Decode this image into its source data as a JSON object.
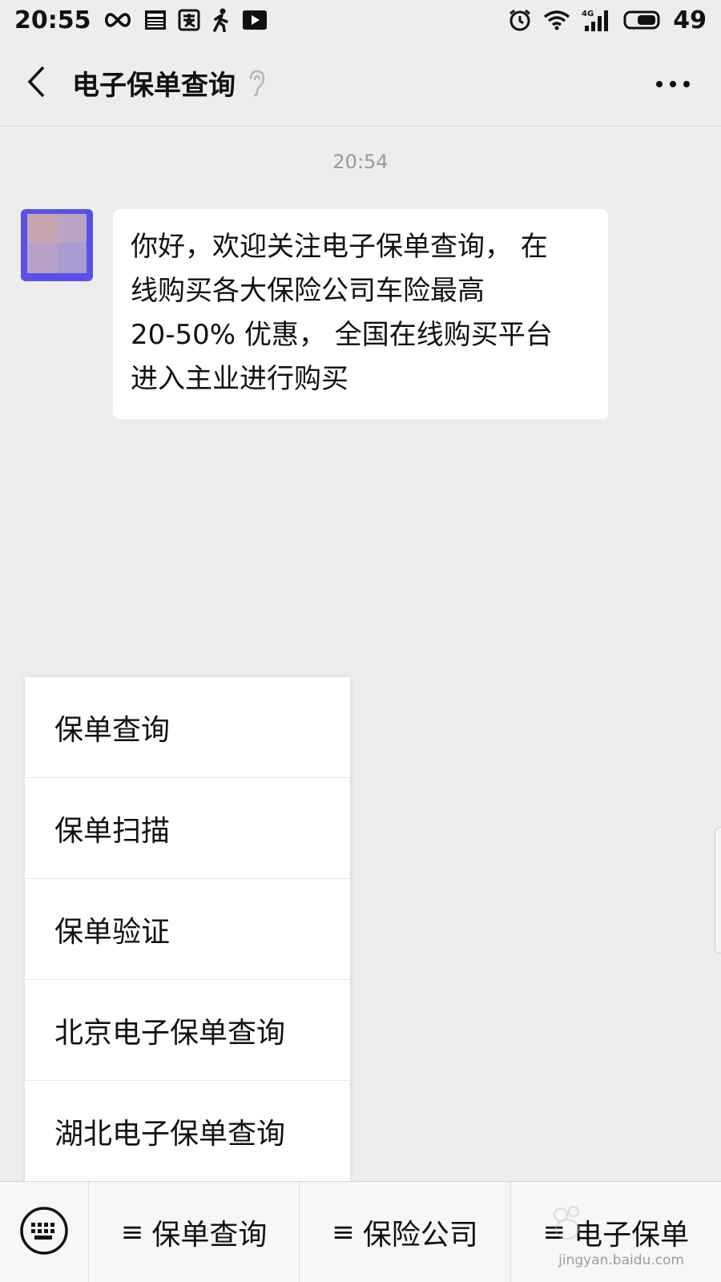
{
  "status_bar": {
    "time": "20:55",
    "battery_level": "49",
    "left_icons": [
      "infinity-icon",
      "news-icon",
      "pay-icon",
      "walk-icon",
      "video-icon"
    ],
    "right_icons": [
      "alarm-icon",
      "wifi-icon",
      "signal-4g-icon",
      "battery-icon"
    ],
    "network_label": "4G"
  },
  "nav": {
    "title": "电子保单查询",
    "back_icon": "chevron-left-icon",
    "ear_icon": "ear-icon",
    "more_icon": "more-icon"
  },
  "chat": {
    "timestamp": "20:54",
    "message_lines": [
      "你好，欢迎关注电子保单查询， 在",
      "线购买各大保险公司车险最高",
      "20-50% 优惠， 全国在线购买平台",
      "进入主业进行购买"
    ]
  },
  "popup_menu": {
    "items": [
      "保单查询",
      "保单扫描",
      "保单验证",
      "北京电子保单查询",
      "湖北电子保单查询"
    ]
  },
  "bottom_menu": {
    "keyboard_icon": "keyboard-icon",
    "tab_icon": "≡",
    "tabs": [
      "保单查询",
      "保险公司",
      "电子保单"
    ]
  },
  "watermark": {
    "text": "jingyan.baidu.com"
  },
  "colors": {
    "background": "#ededed",
    "bubble": "#ffffff",
    "avatar": "#5a52e6",
    "timestamp": "#9a9a9a"
  }
}
